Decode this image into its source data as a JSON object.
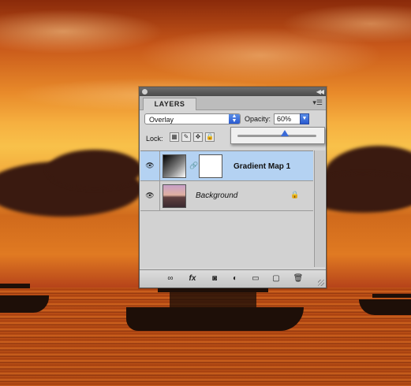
{
  "panel": {
    "tab_label": "LAYERS",
    "blend_mode": "Overlay",
    "opacity_label": "Opacity:",
    "opacity_value": "60%",
    "opacity_fraction": 0.6,
    "lock_label": "Lock:",
    "layers": [
      {
        "name": "Gradient Map 1",
        "selected": true,
        "visible": true,
        "type": "adjustment"
      },
      {
        "name": "Background",
        "selected": false,
        "visible": true,
        "locked": true,
        "type": "image"
      }
    ],
    "bottom_icons": [
      "link-layers-icon",
      "fx-icon",
      "layer-mask-icon",
      "adjustment-layer-icon",
      "new-group-icon",
      "new-layer-icon",
      "trash-icon"
    ]
  },
  "colors": {
    "selection": "#b4d2f2",
    "accent_blue": "#3a6ad8"
  }
}
